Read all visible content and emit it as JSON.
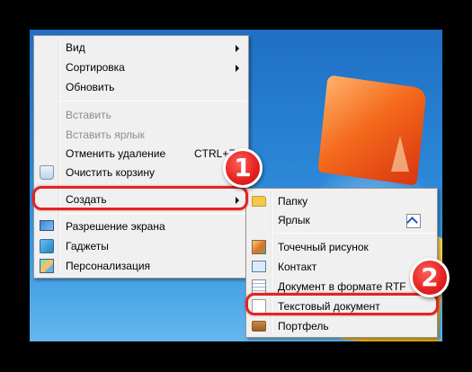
{
  "colors": {
    "menu_background": "#f0f0f0",
    "highlight_outline": "#e32322",
    "badge_fill": "#e3211f",
    "desktop_blue": "#2b86d6"
  },
  "context_menu": {
    "view": "Вид",
    "sort": "Сортировка",
    "refresh": "Обновить",
    "paste": "Вставить",
    "paste_shortcut": "Вставить ярлык",
    "undo_delete": "Отменить удаление",
    "undo_delete_shortcut": "CTRL+Z",
    "empty_recycle_bin": "Очистить корзину",
    "create": "Создать",
    "screen_resolution": "Разрешение экрана",
    "gadgets": "Гаджеты",
    "personalize": "Персонализация"
  },
  "submenu": {
    "folder": "Папку",
    "shortcut": "Ярлык",
    "bitmap": "Точечный рисунок",
    "contact": "Контакт",
    "rtf_document": "Документ в формате RTF",
    "text_document": "Текстовый документ",
    "briefcase": "Портфель"
  },
  "icons": {
    "recycle": "recycle-bin-icon",
    "screen": "screen-resolution-icon",
    "gadgets": "gadgets-icon",
    "personalize": "personalize-icon",
    "folder": "folder-icon",
    "shortcut": "shortcut-icon",
    "bitmap": "bitmap-icon",
    "contact": "contact-icon",
    "rtf": "rtf-document-icon",
    "text": "text-document-icon",
    "briefcase": "briefcase-icon"
  },
  "annotations": {
    "step1": "1",
    "step2": "2"
  }
}
